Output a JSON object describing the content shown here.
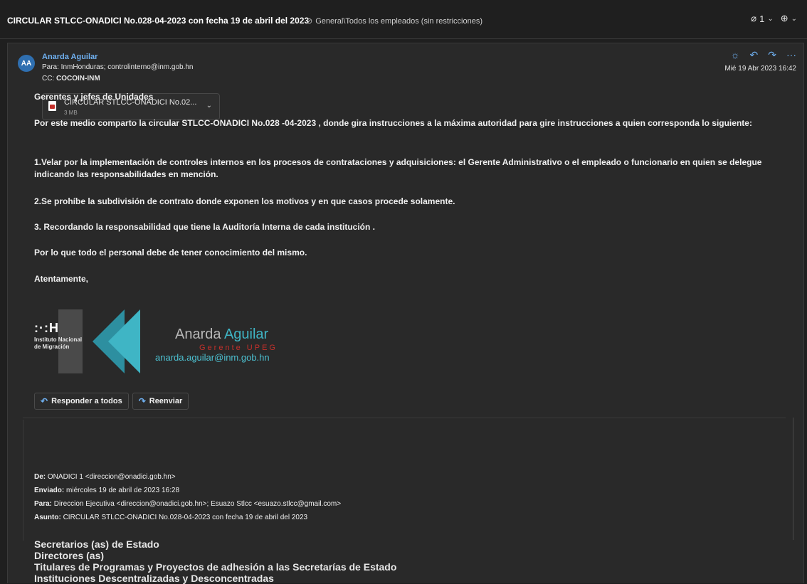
{
  "header": {
    "subject": "CIRCULAR STLCC-ONADICI No.028-04-2023 con fecha 19 de abril del 2023",
    "sensitivity": "General\\Todos los empleados (sin restricciones)",
    "attachments_count": "1",
    "icons": [
      "tag-icon",
      "paperclip-icon",
      "zoom-icon"
    ]
  },
  "message": {
    "avatar_initials": "AA",
    "sender": "Anarda Aguilar",
    "to": "Para: InmHonduras; controlinterno@inm.gob.hn",
    "cc_label": "CC:",
    "cc_value": "COCOIN-INM",
    "date": "Mié 19 Abr 2023 16:42",
    "attachment": {
      "name": "CIRCULAR STLCC-ONADICI No.02...",
      "size": "3 MB"
    },
    "body": [
      "Gerentes y jefes de Unidades",
      "Por este medio comparto la circular STLCC-ONADICI No.028 -04-2023 , donde gira instrucciones a la máxima autoridad para gire instrucciones a quien corresponda lo siguiente:",
      "1.Velar por la implementación de controles internos en los procesos de contrataciones y adquisiciones: el Gerente Administrativo o el empleado o funcionario en quien se delegue indicando las responsabilidades en mención.",
      "2.Se prohíbe la subdivisión de contrato donde exponen los motivos y en que casos procede solamente.",
      "3.  Recordando la responsabilidad que tiene la Auditoría Interna de cada institución .",
      "Por lo que todo el personal debe de tener conocimiento del mismo.",
      "Atentamente,"
    ],
    "signature": {
      "logo_mark": ":·:H",
      "logo_line1": "Instituto Nacional",
      "logo_line2": "de Migración",
      "first_name": "Anarda",
      "last_name": "Aguilar",
      "role": "Gerente UPEG",
      "email": "anarda.aguilar@inm.gob.hn"
    },
    "reply_all_label": "Responder a todos",
    "forward_label": "Reenviar"
  },
  "forwarded": {
    "from_label": "De:",
    "from_value": "ONADICI 1 <direccion@onadici.gob.hn>",
    "sent_label": "Enviado:",
    "sent_value": "miércoles 19 de abril de 2023 16:28",
    "to_label": "Para:",
    "to_value": "Direccion Ejecutiva <direccion@onadici.gob.hn>; Esuazo Stlcc <esuazo.stlcc@gmail.com>",
    "subject_label": "Asunto:",
    "subject_value": "CIRCULAR STLCC-ONADICI No.028-04-2023 con fecha 19 de abril del 2023",
    "lines": [
      "Secretarios (as) de Estado",
      "Directores (as)",
      "Titulares de Programas y Proyectos de adhesión a las Secretarías de Estado",
      "Instituciones Descentralizadas y Desconcentradas"
    ]
  },
  "colors": {
    "accent": "#6fb0f0",
    "bg": "#1f1f1f",
    "card": "#292929",
    "red": "#c4302b",
    "teal": "#3fb5c5"
  }
}
